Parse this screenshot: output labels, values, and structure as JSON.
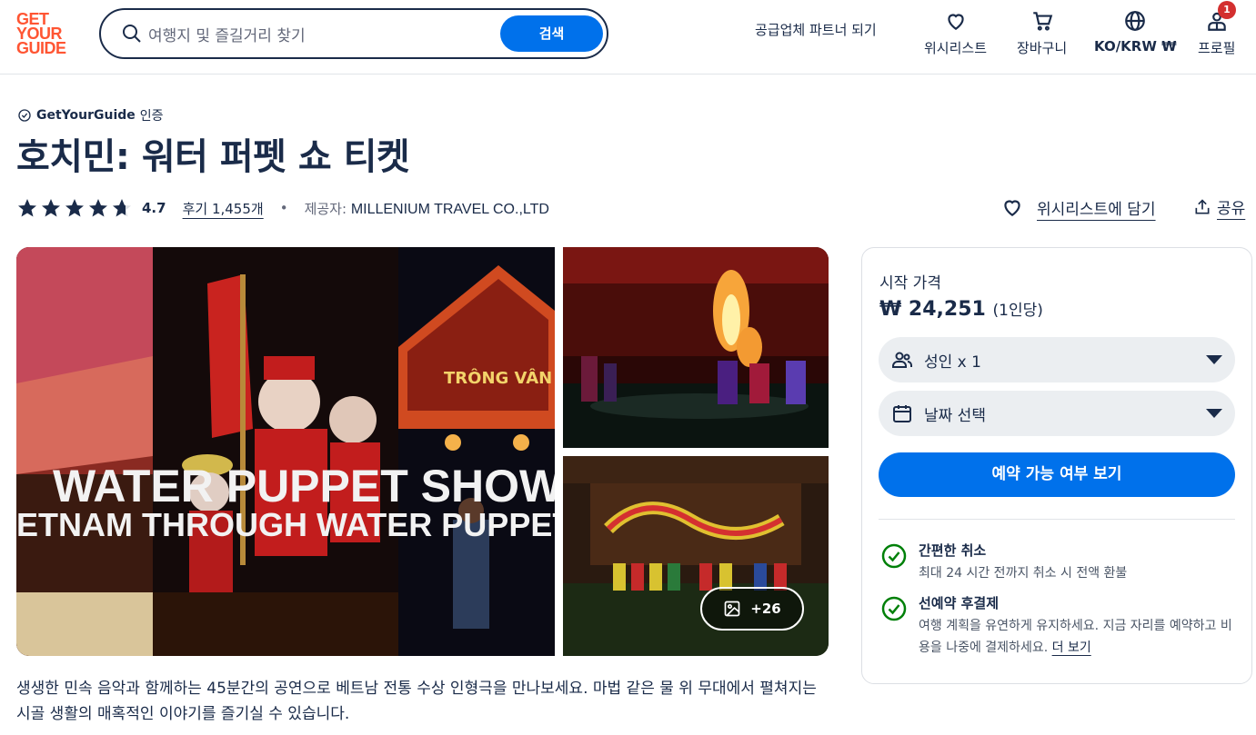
{
  "header": {
    "logo": [
      "GET",
      "YOUR",
      "GUIDE"
    ],
    "search_placeholder": "여행지 및 즐길거리 찾기",
    "search_button": "검색",
    "partner_link": "공급업체 파트너 되기",
    "nav": {
      "wishlist": "위시리스트",
      "cart": "장바구니",
      "locale": "KO/KRW ₩",
      "profile": "프로필",
      "profile_badge": "1"
    }
  },
  "product": {
    "verified_brand": "GetYourGuide",
    "verified_suffix": "인증",
    "title": "호치민: 워터 퍼펫 쇼 티켓",
    "rating": "4.7",
    "rating_value": 4.7,
    "reviews": "후기 1,455개",
    "provider_label": "제공자:",
    "provider_name": "MILLENIUM TRAVEL CO.,LTD",
    "wishlist_action": "위시리스트에 담기",
    "share_action": "공유"
  },
  "gallery": {
    "main_caption_1": "WATER PUPPET SHOW",
    "main_caption_2": "ETNAM THROUGH WATER PUPPETRY",
    "sign_text": "TRÔNG VÂN",
    "more_count": "+26"
  },
  "description": "생생한 민속 음악과 함께하는 45분간의 공연으로 베트남 전통 수상 인형극을 만나보세요. 마법 같은 물 위 무대에서 펼쳐지는 시골 생활의 매혹적인 이야기를 즐기실 수 있습니다.",
  "booking": {
    "from_label": "시작 가격",
    "price": "₩ 24,251",
    "price_unit": "(1인당)",
    "participants": "성인 x 1",
    "date": "날짜 선택",
    "cta": "예약 가능 여부 보기",
    "features": [
      {
        "title": "간편한 취소",
        "text": "최대 24 시간 전까지 취소 시 전액 환불"
      },
      {
        "title": "선예약 후결제",
        "text": "여행 계획을 유연하게 유지하세요. 지금 자리를 예약하고 비용을 나중에 결제하세요.",
        "link": "더 보기"
      }
    ]
  },
  "colors": {
    "brand": "#ff5533",
    "primary": "#0071eb",
    "text": "#1a2b49",
    "check": "#008009"
  }
}
